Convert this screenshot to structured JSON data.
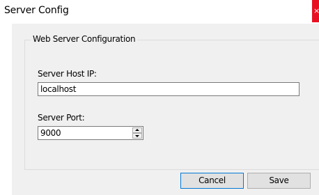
{
  "window": {
    "title": "Server Config",
    "close_glyph": "×",
    "close_color": "#e81123"
  },
  "group": {
    "legend": "Web Server Configuration"
  },
  "host": {
    "label": "Server Host IP:",
    "value": "localhost"
  },
  "port": {
    "label": "Server Port:",
    "value": "9000"
  },
  "buttons": {
    "cancel": "Cancel",
    "save": "Save"
  },
  "colors": {
    "client_background": "#f0f0f0",
    "default_button_border": "#0078d7"
  }
}
